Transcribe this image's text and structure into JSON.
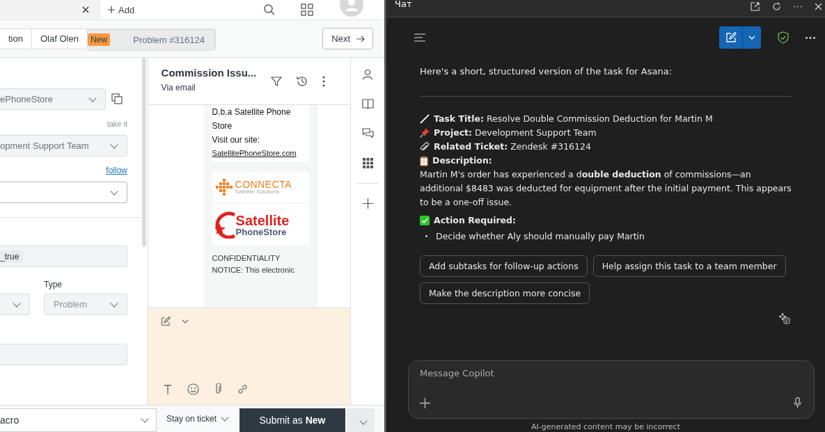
{
  "top_bar": {
    "add_tab": "Add"
  },
  "ticket_tabs": [
    {
      "label": "tion",
      "selected": false
    },
    {
      "label": "Olaf Olen",
      "selected": false
    },
    {
      "label": "Problem #316124",
      "badge": "New",
      "selected": true
    }
  ],
  "next_button": "Next",
  "form": {
    "org_value": "ePhoneStore",
    "take_it": "take it",
    "group_value": "opment Support Team",
    "follow": "follow",
    "tag": "_true",
    "type_label": "Type",
    "type_value": "Problem"
  },
  "conversation": {
    "title": "Commission Issu...",
    "channel": "Via email",
    "company": "D.b.a Satellite Phone Store",
    "visit": "Visit our site:",
    "link": "SatellitePhoneStore.com",
    "connecta": {
      "name": "CONNECTA",
      "tagline": "Satellite Solutions"
    },
    "store_logo": {
      "name": "Satellite",
      "sub": "PhoneStore"
    },
    "notice": "CONFIDENTIALITY NOTICE: This electronic"
  },
  "footer": {
    "macro": "acro",
    "after_submit": "Stay on ticket",
    "submit": "Submit as **New**"
  },
  "chat": {
    "title": "Чат",
    "intro": "Here's a short, structured version of the task for Asana:",
    "fields": [
      {
        "kind": "title",
        "label": "Task Title:",
        "value": "Resolve Double Commission Deduction for Martin M"
      },
      {
        "kind": "project",
        "label": "Project:",
        "value": "Development Support Team"
      },
      {
        "kind": "ticket",
        "label": "Related Ticket:",
        "value": "Zendesk #316124"
      },
      {
        "kind": "description",
        "label": "Description:"
      }
    ],
    "description": "Martin M's order has experienced a d**ouble deduction** of commissions—an additional $8483 was deducted for equipment after the initial payment. This appears to be a one-off issue.",
    "action_label": "Action Required:",
    "actions": [
      "Decide whether Aly should manually pay Martin"
    ],
    "suggestions": [
      "Add subtasks for follow-up actions",
      "Help assign this task to a team member",
      "Make the description more concise"
    ],
    "placeholder": "Message Copilot",
    "disclaimer": "AI-generated content may be incorrect"
  }
}
